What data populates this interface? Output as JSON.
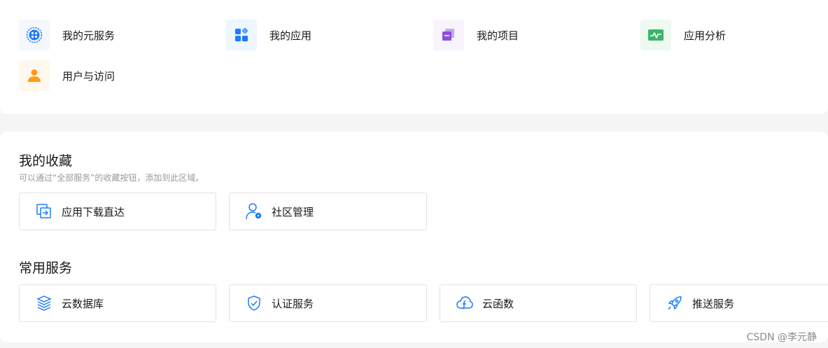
{
  "quick_links": [
    {
      "label": "我的元服务",
      "icon": "atomic-service-icon"
    },
    {
      "label": "我的应用",
      "icon": "apps-grid-icon"
    },
    {
      "label": "我的项目",
      "icon": "project-stack-icon"
    },
    {
      "label": "应用分析",
      "icon": "analytics-chart-icon"
    },
    {
      "label": "用户与访问",
      "icon": "user-icon"
    }
  ],
  "favorites": {
    "title": "我的收藏",
    "hint": "可以通过“全部服务”的收藏按钮，添加到此区域。",
    "items": [
      {
        "label": "应用下载直达",
        "icon": "download-direct-icon"
      },
      {
        "label": "社区管理",
        "icon": "community-admin-icon"
      }
    ]
  },
  "common_services": {
    "title": "常用服务",
    "items": [
      {
        "label": "云数据库",
        "icon": "cloud-database-icon"
      },
      {
        "label": "认证服务",
        "icon": "auth-shield-icon"
      },
      {
        "label": "云函数",
        "icon": "cloud-function-icon"
      },
      {
        "label": "推送服务",
        "icon": "push-rocket-icon"
      }
    ]
  },
  "watermark": "CSDN @李元静",
  "colors": {
    "blue": "#1d7bff",
    "purple": "#8a4fe0",
    "green": "#3bb56a",
    "orange": "#ff9c1a"
  }
}
